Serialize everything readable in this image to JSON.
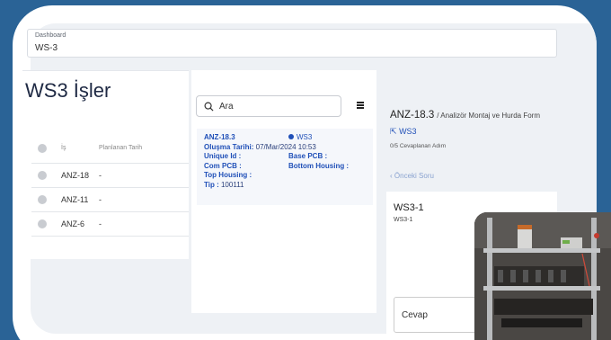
{
  "breadcrumb": {
    "section": "Dashboard",
    "page": "WS-3"
  },
  "left": {
    "title": "WS3 İşler",
    "columns": [
      "İş",
      "Planlanan Tarih"
    ],
    "rows": [
      {
        "id": "ANZ-18",
        "date": "-"
      },
      {
        "id": "ANZ-11",
        "date": "-"
      },
      {
        "id": "ANZ-6",
        "date": "-"
      }
    ]
  },
  "middle": {
    "search_placeholder": "Ara",
    "card": {
      "id": "ANZ-18.3",
      "station": "WS3",
      "created_label": "Oluşma Tarihi:",
      "created_value": "07/Mar/2024 10:53",
      "unique_label": "Unique Id :",
      "base_label": "Base PCB :",
      "com_label": "Com PCB :",
      "bottom_label": "Bottom Housing :",
      "top_label": "Top Housing :",
      "tip_label": "Tip :",
      "tip_value": "100111"
    }
  },
  "right": {
    "title": "ANZ-18.3",
    "subtitle": "/ Analizör Montaj ve Hurda Form",
    "station": "WS3",
    "progress": "0/5 Cevaplanan Adım",
    "prev_label": "Önceki Soru",
    "question_title": "WS3-1",
    "question_sub": "WS3-1",
    "answer_label": "Cevap"
  },
  "colors": {
    "accent": "#2050b8",
    "background": "#2a6396"
  }
}
